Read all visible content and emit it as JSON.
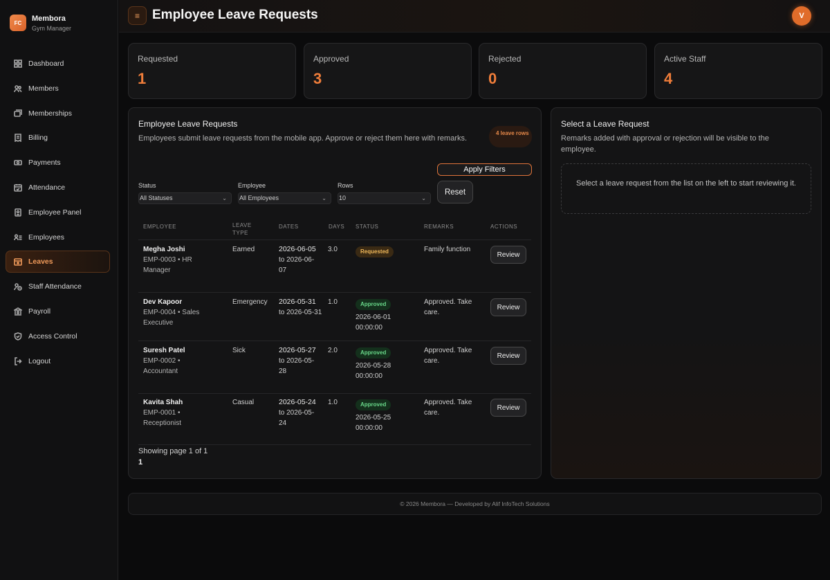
{
  "brand": {
    "logo": "FC",
    "name": "Membora",
    "subtitle": "Gym Manager"
  },
  "nav": [
    {
      "label": "Dashboard",
      "icon": "grid-icon"
    },
    {
      "label": "Members",
      "icon": "users-icon"
    },
    {
      "label": "Memberships",
      "icon": "cards-icon"
    },
    {
      "label": "Billing",
      "icon": "receipt-icon"
    },
    {
      "label": "Payments",
      "icon": "cash-icon"
    },
    {
      "label": "Attendance",
      "icon": "calendar-check-icon"
    },
    {
      "label": "Employee Panel",
      "icon": "id-badge-icon"
    },
    {
      "label": "Employees",
      "icon": "user-list-icon"
    },
    {
      "label": "Leaves",
      "icon": "calendar-x-icon",
      "active": true
    },
    {
      "label": "Staff Attendance",
      "icon": "user-clock-icon"
    },
    {
      "label": "Payroll",
      "icon": "bank-icon"
    },
    {
      "label": "Access Control",
      "icon": "shield-icon"
    },
    {
      "label": "Logout",
      "icon": "logout-icon"
    }
  ],
  "topbar": {
    "menu_icon": "≡",
    "title": "Employee Leave Requests",
    "avatar": "V"
  },
  "stats": [
    {
      "label": "Requested",
      "value": "1"
    },
    {
      "label": "Approved",
      "value": "3"
    },
    {
      "label": "Rejected",
      "value": "0"
    },
    {
      "label": "Active Staff",
      "value": "4"
    }
  ],
  "requests_panel": {
    "title": "Employee Leave Requests",
    "description": "Employees submit leave requests from the mobile app. Approve or reject them here with remarks.",
    "rows_badge": "4 leave rows",
    "apply_label": "Apply Filters",
    "reset_label": "Reset",
    "filters": [
      {
        "label": "Status",
        "value": "All Statuses"
      },
      {
        "label": "Employee",
        "value": "All Employees"
      },
      {
        "label": "Rows",
        "value": "10"
      }
    ],
    "columns": [
      "EMPLOYEE",
      "LEAVE TYPE",
      "DATES",
      "DAYS",
      "STATUS",
      "REMARKS",
      "ACTIONS"
    ],
    "rows": [
      {
        "name": "Megha Joshi",
        "emp": "EMP-0003 • HR Manager",
        "type": "Earned",
        "from": "2026-06-05",
        "to": "to 2026-06-07",
        "days": "3.0",
        "status": "Requested",
        "status_date": "",
        "remarks": "Family function",
        "action": "Review"
      },
      {
        "name": "Dev Kapoor",
        "emp": "EMP-0004 • Sales Executive",
        "type": "Emergency",
        "from": "2026-05-31",
        "to": "to 2026-05-31",
        "days": "1.0",
        "status": "Approved",
        "status_date": "2026-06-01 00:00:00",
        "remarks": "Approved. Take care.",
        "action": "Review"
      },
      {
        "name": "Suresh Patel",
        "emp": "EMP-0002 • Accountant",
        "type": "Sick",
        "from": "2026-05-27",
        "to": "to 2026-05-28",
        "days": "2.0",
        "status": "Approved",
        "status_date": "2026-05-28 00:00:00",
        "remarks": "Approved. Take care.",
        "action": "Review"
      },
      {
        "name": "Kavita Shah",
        "emp": "EMP-0001 • Receptionist",
        "type": "Casual",
        "from": "2026-05-24",
        "to": "to 2026-05-24",
        "days": "1.0",
        "status": "Approved",
        "status_date": "2026-05-25 00:00:00",
        "remarks": "Approved. Take care.",
        "action": "Review"
      }
    ],
    "paging_text": "Showing page 1 of 1",
    "paging_current": "1"
  },
  "detail_panel": {
    "title": "Select a Leave Request",
    "description": "Remarks added with approval or rejection will be visible to the employee.",
    "empty_text": "Select a leave request from the list on the left to start reviewing it."
  },
  "footer": {
    "text": "© 2026 Membora — Developed by Alif InfoTech Solutions"
  },
  "colors": {
    "accent": "#ef7d3a",
    "approved": "#69d88a",
    "requested": "#f0b85a"
  }
}
